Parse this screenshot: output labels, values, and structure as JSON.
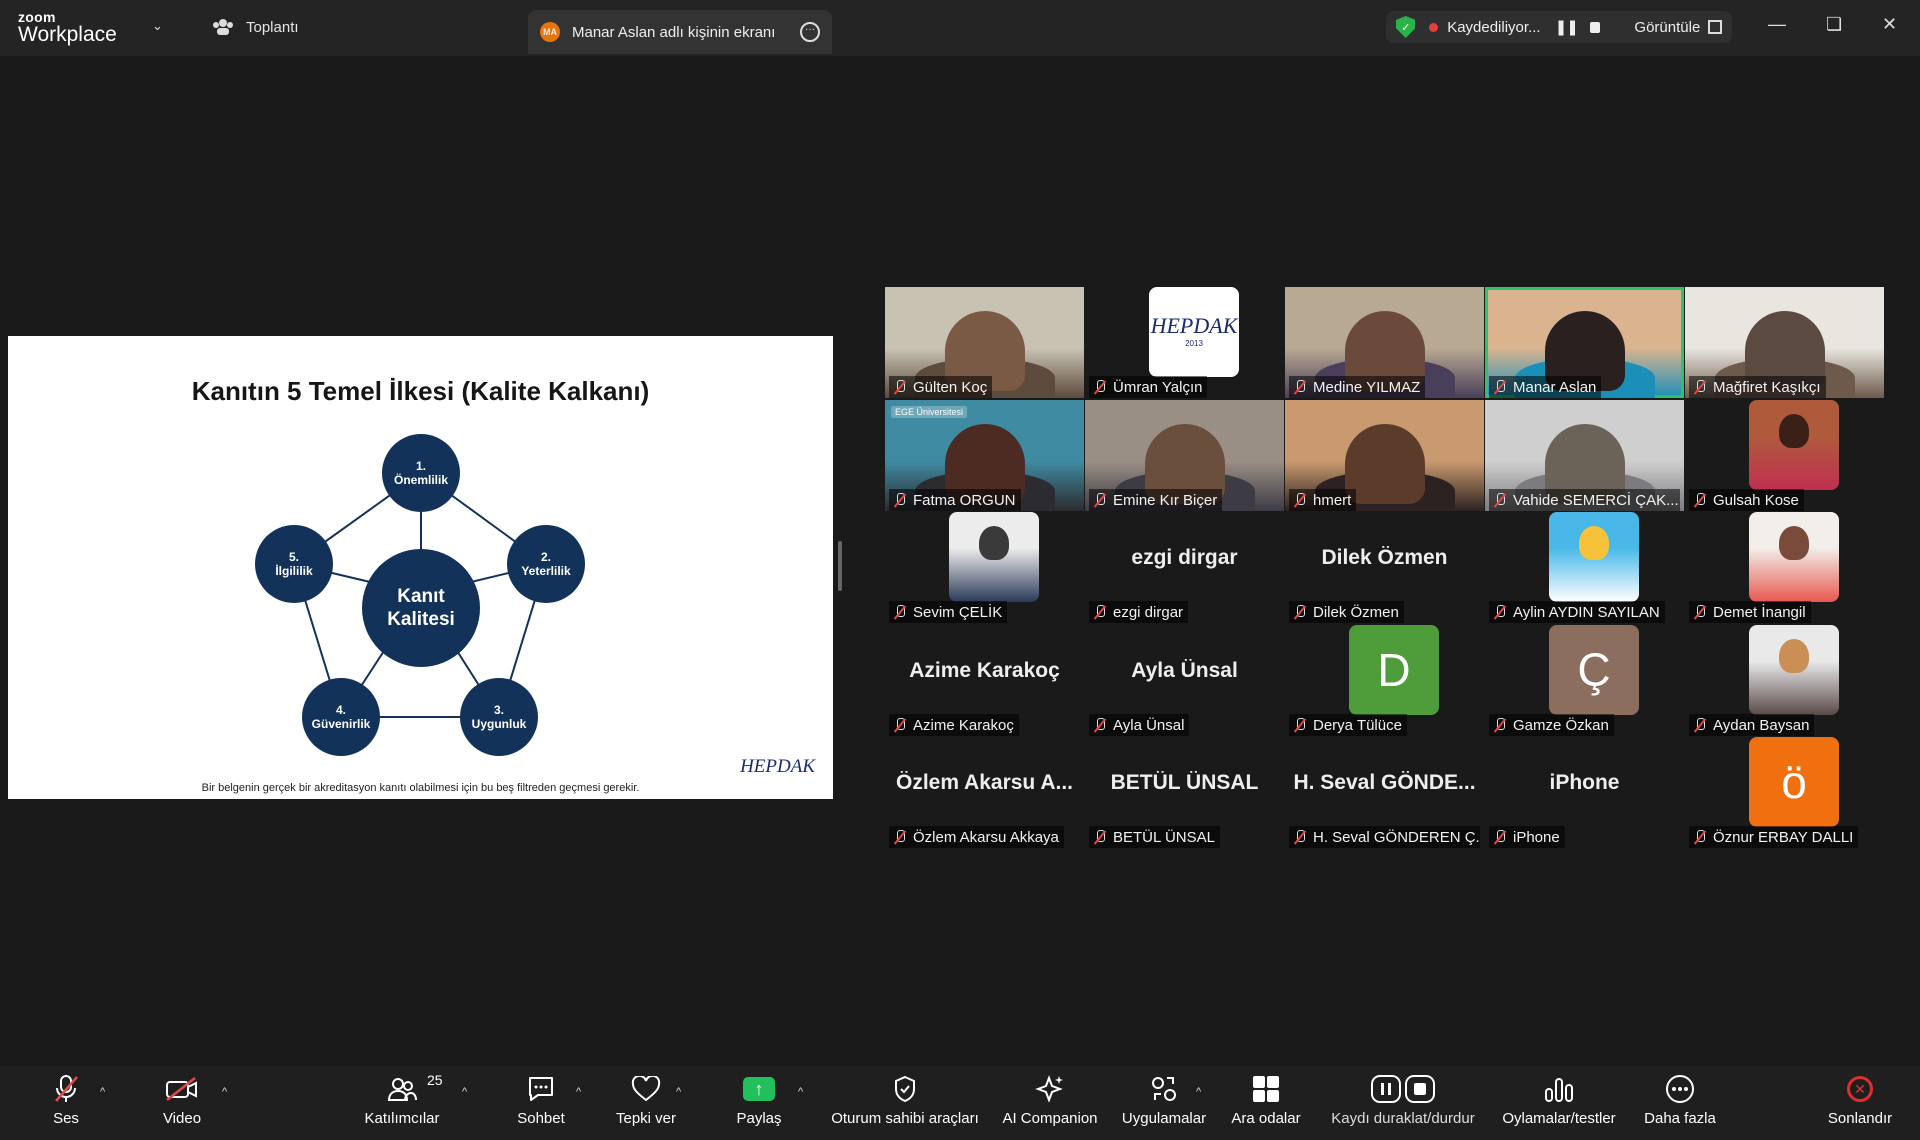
{
  "window": {
    "app_brand_small": "zoom",
    "app_brand": "Workplace",
    "meeting_label": "Toplantı",
    "share_tab_initials": "MA",
    "share_tab_label": "Manar Aslan adlı kişinin ekranı",
    "recording_label": "Kaydediliyor...",
    "view_label": "Görüntüle"
  },
  "slide": {
    "title": "Kanıtın 5 Temel İlkesi (Kalite Kalkanı)",
    "center_line1": "Kanıt",
    "center_line2": "Kalitesi",
    "nodes": [
      {
        "num": "1.",
        "label": "Önemlilik"
      },
      {
        "num": "2.",
        "label": "Yeterlilik"
      },
      {
        "num": "3.",
        "label": "Uygunluk"
      },
      {
        "num": "4.",
        "label": "Güvenirlik"
      },
      {
        "num": "5.",
        "label": "İlgililik"
      }
    ],
    "footer": "Bir belgenin gerçek bir akreditasyon kanıtı olabilmesi için bu beş filtreden geçmesi gerekir.",
    "logo_text": "HEPDAK"
  },
  "participants": [
    {
      "name": "Gülten Koç",
      "kind": "video",
      "colors": [
        "#c8c2b3",
        "#7a5a45",
        "#5d4b3d"
      ]
    },
    {
      "name": "Ümran Yalçın",
      "kind": "logo",
      "logo_text": "HEPDAK",
      "logo_year": "2013"
    },
    {
      "name": "Medine YILMAZ",
      "kind": "video",
      "colors": [
        "#b8a992",
        "#6b4a3c",
        "#4a3f5a"
      ]
    },
    {
      "name": "Manar Aslan",
      "kind": "video",
      "active": true,
      "colors": [
        "#d9b48f",
        "#2b2020",
        "#1b8fb8"
      ]
    },
    {
      "name": "Mağfiret Kaşıkçı",
      "kind": "video",
      "colors": [
        "#e9e6df",
        "#5a4a40",
        "#6d5a4c"
      ]
    },
    {
      "name": "Fatma ORGUN",
      "kind": "video",
      "colors": [
        "#3f8ba2",
        "#4b2b22",
        "#2c2c30"
      ],
      "overlay_text": "EGE Üniversitesi"
    },
    {
      "name": "Emine Kır Biçer",
      "kind": "video",
      "colors": [
        "#9a8f85",
        "#6a4f3d",
        "#3d3b44"
      ]
    },
    {
      "name": "hmert",
      "kind": "video",
      "colors": [
        "#c99a70",
        "#5b3c2a",
        "#2d2222"
      ]
    },
    {
      "name": "Vahide SEMERCİ ÇAK...",
      "kind": "video",
      "colors": [
        "#cfcfcf",
        "#6b6358",
        "#7c7c80"
      ]
    },
    {
      "name": "Gulsah Kose",
      "kind": "avatar",
      "colors": [
        "#b05a3c",
        "#3b2018",
        "#c03050"
      ]
    },
    {
      "name": "Sevim ÇELİK",
      "kind": "avatar",
      "colors": [
        "#ececec",
        "#3a3a3a",
        "#2b3a5a"
      ]
    },
    {
      "name": "ezgi dirgar",
      "kind": "name"
    },
    {
      "name": "Dilek Özmen",
      "kind": "name"
    },
    {
      "name": "Aylin AYDIN SAYILAN",
      "kind": "avatar",
      "colors": [
        "#49b8e8",
        "#f6c23a",
        "#ffffff"
      ]
    },
    {
      "name": "Demet İnangil",
      "kind": "avatar",
      "colors": [
        "#f2eee9",
        "#7a4a3a",
        "#e8574f"
      ]
    },
    {
      "name": "Azime Karakoç",
      "kind": "name"
    },
    {
      "name": "Ayla Ünsal",
      "kind": "name"
    },
    {
      "name": "Derya Tülüce",
      "kind": "initial",
      "initial": "D",
      "color": "#4e9c3a"
    },
    {
      "name": "Gamze Özkan",
      "kind": "initial",
      "initial": "Ç",
      "color": "#8c6e5f"
    },
    {
      "name": "Aydan Baysan",
      "kind": "avatar",
      "colors": [
        "#e9e9ea",
        "#c98f55",
        "#5a4a48"
      ]
    },
    {
      "name": "Özlem Akarsu Akkaya",
      "kind": "name",
      "big": "Özlem Akarsu A..."
    },
    {
      "name": "BETÜL ÜNSAL",
      "kind": "name"
    },
    {
      "name": "H. Seval GÖNDEREN Ç...",
      "kind": "name",
      "big": "H. Seval GÖNDE..."
    },
    {
      "name": "iPhone",
      "kind": "name"
    },
    {
      "name": "Öznur ERBAY DALLI",
      "kind": "initial",
      "initial": "ö",
      "color": "#f07010"
    }
  ],
  "toolbar": {
    "audio": "Ses",
    "video": "Video",
    "participants": "Katılımcılar",
    "participants_count": "25",
    "chat": "Sohbet",
    "react": "Tepki ver",
    "share": "Paylaş",
    "host_tools": "Oturum sahibi araçları",
    "ai_companion": "AI Companion",
    "apps": "Uygulamalar",
    "breakout": "Ara odalar",
    "record_pause": "Kaydı duraklat/durdur",
    "polls": "Oylamalar/testler",
    "more": "Daha fazla",
    "end": "Sonlandır"
  },
  "colors": {
    "accent_green": "#21c05d",
    "end_red": "#e02e2e",
    "slide_node": "#13325a",
    "active_speaker": "#2cc46a"
  }
}
